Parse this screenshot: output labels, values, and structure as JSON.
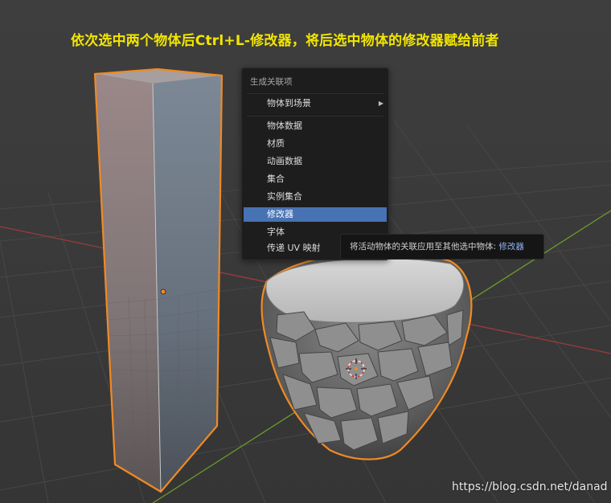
{
  "annotation": "依次选中两个物体后Ctrl+L-修改器，将后选中物体的修改器赋给前者",
  "menu": {
    "title": "生成关联项",
    "submenu_item": "物体到场景",
    "items": [
      "物体数据",
      "材质",
      "动画数据",
      "集合",
      "实例集合",
      "修改器",
      "字体",
      "传递 UV 映射"
    ],
    "active_item": "修改器"
  },
  "tooltip": {
    "text": "将活动物体的关联应用至其他选中物体: ",
    "highlight": "修改器"
  },
  "watermark": "https://blog.csdn.net/danad",
  "colors": {
    "annotation": "#f2e600",
    "selection_outline": "#f08a24",
    "menu_highlight": "#4772b3",
    "x_axis": "#9e3b3b",
    "y_axis": "#6d9a2c",
    "background": "#3d3d3d"
  }
}
